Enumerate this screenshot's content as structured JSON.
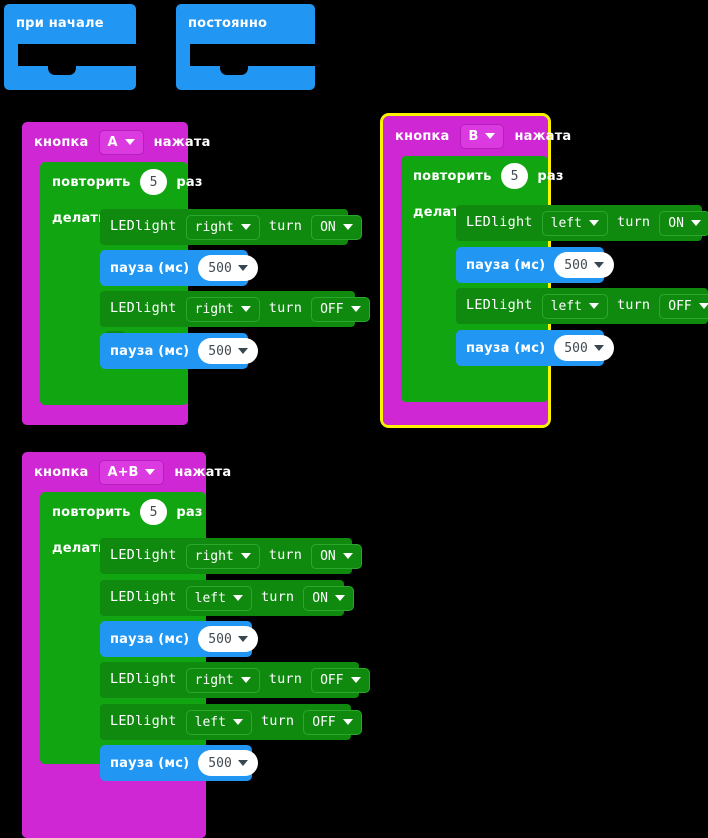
{
  "workspace": {
    "background": "#000000",
    "palette": {
      "event_magenta": "#cf27d4",
      "loop_green": "#11a611",
      "led_green": "#0f8a0f",
      "pause_blue": "#2196f3",
      "selection_yellow": "#fdf200",
      "field_white": "#ffffff",
      "field_text": "#424b52"
    }
  },
  "blocks": {
    "on_start": {
      "label": "при начале",
      "color": "#2196f3",
      "body": []
    },
    "forever": {
      "label": "постоянно",
      "color": "#2196f3",
      "body": []
    },
    "button_a": {
      "prefix": "кнопка",
      "button": "A",
      "suffix": "нажата",
      "selected": false,
      "loop": {
        "prefix": "повторить",
        "count": "5",
        "suffix": "раз",
        "do_label": "делать",
        "statements": [
          {
            "kind": "led",
            "name": "LEDlight",
            "side": "right",
            "mid": "turn",
            "state": "ON"
          },
          {
            "kind": "pause",
            "name": "пауза (мс)",
            "value": "500"
          },
          {
            "kind": "led",
            "name": "LEDlight",
            "side": "right",
            "mid": "turn",
            "state": "OFF"
          },
          {
            "kind": "pause",
            "name": "пауза (мс)",
            "value": "500"
          }
        ]
      }
    },
    "button_b": {
      "prefix": "кнопка",
      "button": "B",
      "suffix": "нажата",
      "selected": true,
      "loop": {
        "prefix": "повторить",
        "count": "5",
        "suffix": "раз",
        "do_label": "делать",
        "statements": [
          {
            "kind": "led",
            "name": "LEDlight",
            "side": "left",
            "mid": "turn",
            "state": "ON"
          },
          {
            "kind": "pause",
            "name": "пауза (мс)",
            "value": "500"
          },
          {
            "kind": "led",
            "name": "LEDlight",
            "side": "left",
            "mid": "turn",
            "state": "OFF"
          },
          {
            "kind": "pause",
            "name": "пауза (мс)",
            "value": "500"
          }
        ]
      }
    },
    "button_ab": {
      "prefix": "кнопка",
      "button": "A+B",
      "suffix": "нажата",
      "selected": false,
      "loop": {
        "prefix": "повторить",
        "count": "5",
        "suffix": "раз",
        "do_label": "делать",
        "statements": [
          {
            "kind": "led",
            "name": "LEDlight",
            "side": "right",
            "mid": "turn",
            "state": "ON"
          },
          {
            "kind": "led",
            "name": "LEDlight",
            "side": "left",
            "mid": "turn",
            "state": "ON"
          },
          {
            "kind": "pause",
            "name": "пауза (мс)",
            "value": "500"
          },
          {
            "kind": "led",
            "name": "LEDlight",
            "side": "right",
            "mid": "turn",
            "state": "OFF"
          },
          {
            "kind": "led",
            "name": "LEDlight",
            "side": "left",
            "mid": "turn",
            "state": "OFF"
          },
          {
            "kind": "pause",
            "name": "пауза (мс)",
            "value": "500"
          }
        ]
      }
    }
  }
}
